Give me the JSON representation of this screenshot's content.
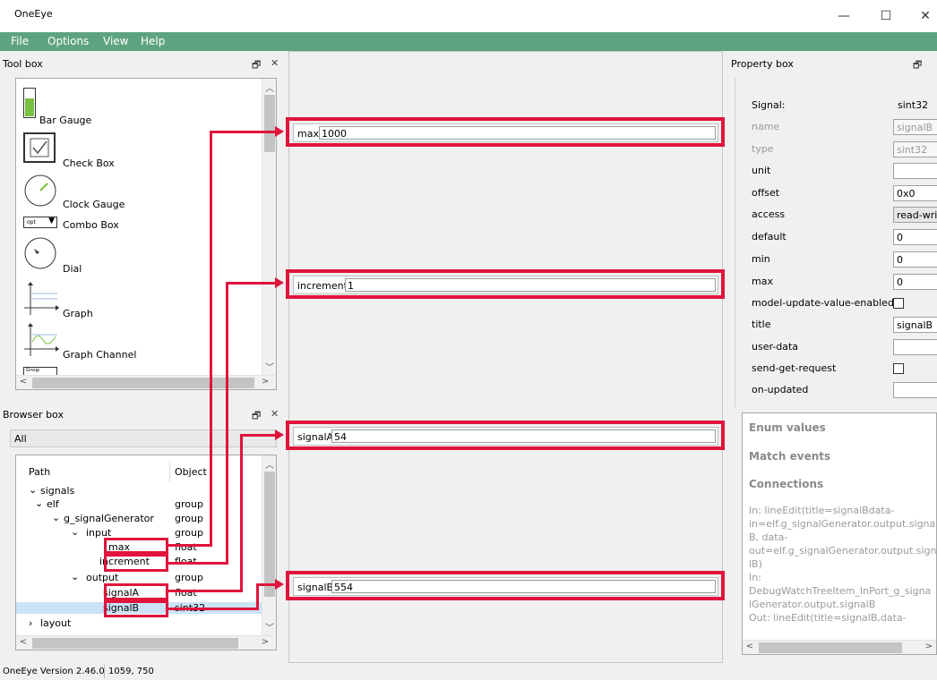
{
  "window": {
    "title": "OneEye",
    "minimize_glyph": "—",
    "maximize_glyph": "☐",
    "close_glyph": "✕"
  },
  "menu": [
    "File",
    "Options",
    "View",
    "Help"
  ],
  "toolbox": {
    "title": "Tool box",
    "float_glyph": "🗗",
    "close_glyph": "✕",
    "items": [
      "Bar Gauge",
      "Check Box",
      "Clock Gauge",
      "Combo Box",
      "Dial",
      "Graph",
      "Graph Channel"
    ],
    "combo_sample": "opt",
    "group_sample": "Group"
  },
  "browser": {
    "title": "Browser box",
    "float_glyph": "🗗",
    "close_glyph": "✕",
    "filter_value": "All",
    "columns": {
      "path": "Path",
      "object": "Object"
    },
    "rows": [
      {
        "path": "signals",
        "object": ""
      },
      {
        "path": "elf",
        "object": "group"
      },
      {
        "path": "g_signalGenerator",
        "object": "group"
      },
      {
        "path": "input",
        "object": "group"
      },
      {
        "path": "max",
        "object": "float"
      },
      {
        "path": "increment",
        "object": "float"
      },
      {
        "path": "output",
        "object": "group"
      },
      {
        "path": "signalA",
        "object": "float"
      },
      {
        "path": "signalB",
        "object": "sint32"
      },
      {
        "path": "layout",
        "object": ""
      }
    ]
  },
  "canvas": {
    "widgets": [
      {
        "label": "max",
        "value": "1000"
      },
      {
        "label": "increment",
        "value": "1"
      },
      {
        "label": "signalA",
        "value": "54"
      },
      {
        "label": "signalB",
        "value": "554"
      }
    ]
  },
  "property": {
    "title": "Property box",
    "float_glyph": "🗗",
    "header": {
      "key": "Signal:",
      "value": "sint32"
    },
    "rows": [
      {
        "key": "name",
        "value": "signalB",
        "readonly": true
      },
      {
        "key": "type",
        "value": "sint32",
        "readonly": true
      },
      {
        "key": "unit",
        "value": ""
      },
      {
        "key": "offset",
        "value": "0x0"
      },
      {
        "key": "access",
        "value": "read-write"
      },
      {
        "key": "default",
        "value": "0"
      },
      {
        "key": "min",
        "value": "0"
      },
      {
        "key": "max",
        "value": "0"
      },
      {
        "key": "model-update-value-enabled",
        "checkbox": true
      },
      {
        "key": "title",
        "value": "signalB"
      },
      {
        "key": "user-data",
        "value": ""
      },
      {
        "key": "send-get-request",
        "checkbox": true
      },
      {
        "key": "on-updated",
        "value": ""
      }
    ],
    "sections": [
      "Enum values",
      "Match events",
      "Connections"
    ],
    "connections_text": [
      "In: lineEdit(title=signalBdata-",
      "in=elf.g_signalGenerator.output.signal",
      "B, data-",
      "out=elf.g_signalGenerator.output.signa",
      "lB)",
      "In:",
      "DebugWatchTreeItem_InPort_g_signa",
      "lGenerator.output.signalB",
      "Out: lineEdit(title=signalB,data-"
    ]
  },
  "status": {
    "version": "OneEye Version 2.46.0",
    "coords": "1059, 750"
  },
  "colors": {
    "menubar": "#5ea380",
    "highlight": "#e0143c",
    "bargauge": "#7ac143"
  }
}
